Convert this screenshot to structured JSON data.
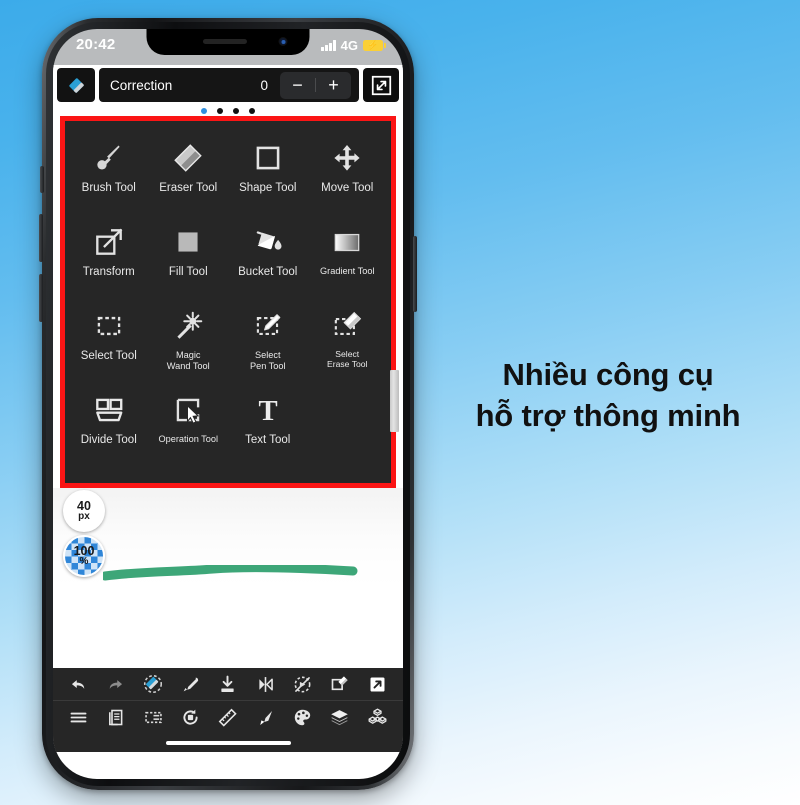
{
  "status_bar": {
    "time": "20:42",
    "network": "4G",
    "signal_icon": "signal-bars-icon",
    "battery_icon": "battery-charging-icon"
  },
  "toolbar": {
    "current_tool_icon": "eraser-correction-icon",
    "slider_label": "Correction",
    "slider_value": "0",
    "decrease_label": "−",
    "increase_label": "+",
    "expand_icon": "expand-fullscreen-icon",
    "page_dots": 4,
    "active_dot": 0
  },
  "tool_panel": {
    "highlight_color": "#fb1515",
    "background": "#262626",
    "tools": [
      {
        "label": "Brush Tool",
        "icon": "brush-icon",
        "size": "md"
      },
      {
        "label": "Eraser Tool",
        "icon": "eraser-icon",
        "size": "md"
      },
      {
        "label": "Shape Tool",
        "icon": "square-outline-icon",
        "size": "md"
      },
      {
        "label": "Move Tool",
        "icon": "move-arrows-icon",
        "size": "md"
      },
      {
        "label": "Transform",
        "icon": "transform-icon",
        "size": "md"
      },
      {
        "label": "Fill Tool",
        "icon": "fill-square-icon",
        "size": "md"
      },
      {
        "label": "Bucket Tool",
        "icon": "paint-bucket-icon",
        "size": "md"
      },
      {
        "label": "Gradient Tool",
        "icon": "gradient-icon",
        "size": "sm"
      },
      {
        "label": "Select Tool",
        "icon": "marquee-select-icon",
        "size": "md"
      },
      {
        "label": "Magic\nWand Tool",
        "icon": "magic-wand-icon",
        "size": "sm"
      },
      {
        "label": "Select\nPen Tool",
        "icon": "select-pen-icon",
        "size": "sm"
      },
      {
        "label": "Select\nErase Tool",
        "icon": "select-erase-icon",
        "size": "xs"
      },
      {
        "label": "Divide Tool",
        "icon": "divide-panels-icon",
        "size": "md"
      },
      {
        "label": "Operation Tool",
        "icon": "operation-cursor-icon",
        "size": "sm"
      },
      {
        "label": "Text Tool",
        "icon": "text-t-icon",
        "size": "md"
      }
    ]
  },
  "canvas": {
    "brush_size_value": "40",
    "brush_size_unit": "px",
    "opacity_value": "100",
    "opacity_unit": "%",
    "stroke_color": "#3da678"
  },
  "bottom_bar": {
    "row1": [
      {
        "icon": "undo-icon"
      },
      {
        "icon": "redo-icon"
      },
      {
        "icon": "correction-eraser-icon"
      },
      {
        "icon": "eyedropper-icon"
      },
      {
        "icon": "import-icon"
      },
      {
        "icon": "flip-horizontal-icon"
      },
      {
        "icon": "snap-off-icon"
      },
      {
        "icon": "layer-eraser-icon"
      },
      {
        "icon": "export-share-icon"
      }
    ],
    "row2": [
      {
        "icon": "menu-hamburger-icon"
      },
      {
        "icon": "pages-icon"
      },
      {
        "icon": "selection-layer-icon"
      },
      {
        "icon": "rotate-canvas-icon"
      },
      {
        "icon": "ruler-icon"
      },
      {
        "icon": "brush-settings-icon"
      },
      {
        "icon": "color-palette-icon"
      },
      {
        "icon": "layers-icon"
      },
      {
        "icon": "3d-model-icon"
      }
    ]
  },
  "promo": {
    "line1": "Nhiều công cụ",
    "line2": "hỗ trợ thông minh"
  }
}
